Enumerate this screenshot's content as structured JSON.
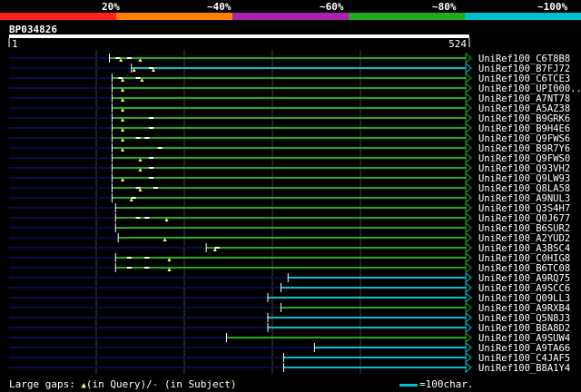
{
  "title": "BP034826",
  "colors": {
    "identity_bar": [
      "#ff2020",
      "#ff7f00",
      "#aa22aa",
      "#22aa22",
      "#00bfcf"
    ],
    "track": "#0a0a50",
    "green": "#22aa22",
    "cyan": "#00bfcf",
    "gap_marker": "#ffff66",
    "gridline": "#444444"
  },
  "identity_scale": [
    "20%",
    "~40%",
    "~60%",
    "~80%",
    "~100%"
  ],
  "legend": {
    "large_gaps": "Large gaps: ",
    "in_query": "(in Query)/",
    "dash": "-",
    "in_subject": " (in Subject)",
    "scale_note": "=100char."
  },
  "chart_data": {
    "type": "alignment",
    "query_start": 1,
    "query_end": 524,
    "start_label": "1",
    "end_label": "524",
    "hits": [
      {
        "name": "UniRef100_C6T8B8",
        "start": 115,
        "end": 520,
        "color": "green",
        "gaps": [
          122,
          135
        ],
        "tris": [
          128,
          150
        ]
      },
      {
        "name": "UniRef100_B7FJ72",
        "start": 140,
        "end": 520,
        "color": "cyan",
        "gaps": [
          160
        ],
        "tris": [
          143,
          165
        ]
      },
      {
        "name": "UniRef100_C6TCE3",
        "start": 118,
        "end": 520,
        "color": "green",
        "gaps": [
          125,
          145
        ],
        "tris": [
          130,
          152
        ]
      },
      {
        "name": "UniRef100_UPI000..",
        "start": 118,
        "end": 520,
        "color": "green",
        "gaps": [],
        "tris": [
          130
        ]
      },
      {
        "name": "UniRef100_A7NT78",
        "start": 118,
        "end": 520,
        "color": "green",
        "gaps": [],
        "tris": [
          130
        ]
      },
      {
        "name": "UniRef100_A5AZ38",
        "start": 118,
        "end": 520,
        "color": "green",
        "gaps": [],
        "tris": [
          130
        ]
      },
      {
        "name": "UniRef100_B9GRK6",
        "start": 118,
        "end": 520,
        "color": "green",
        "gaps": [
          160
        ],
        "tris": [
          130
        ]
      },
      {
        "name": "UniRef100_B9H4E6",
        "start": 118,
        "end": 520,
        "color": "green",
        "gaps": [
          160
        ],
        "tris": [
          130
        ]
      },
      {
        "name": "UniRef100_Q9FWS6",
        "start": 118,
        "end": 520,
        "color": "green",
        "gaps": [
          145,
          155
        ],
        "tris": [
          130
        ]
      },
      {
        "name": "UniRef100_B9R7Y6",
        "start": 118,
        "end": 520,
        "color": "green",
        "gaps": [
          170
        ],
        "tris": [
          130
        ]
      },
      {
        "name": "UniRef100_Q9FWS0",
        "start": 118,
        "end": 520,
        "color": "green",
        "gaps": [
          160
        ],
        "tris": [
          150
        ]
      },
      {
        "name": "UniRef100_Q93VH2",
        "start": 118,
        "end": 520,
        "color": "green",
        "gaps": [
          160
        ],
        "tris": [
          150
        ]
      },
      {
        "name": "UniRef100_Q9LW93",
        "start": 118,
        "end": 520,
        "color": "green",
        "gaps": [
          160
        ],
        "tris": [
          130
        ]
      },
      {
        "name": "UniRef100_Q8LA58",
        "start": 118,
        "end": 520,
        "color": "green",
        "gaps": [
          145,
          165
        ],
        "tris": [
          150
        ]
      },
      {
        "name": "UniRef100_A9NUL3",
        "start": 118,
        "end": 520,
        "color": "green",
        "gaps": [
          140
        ],
        "tris": [
          140
        ]
      },
      {
        "name": "UniRef100_Q3S4H7",
        "start": 122,
        "end": 520,
        "color": "green",
        "gaps": [],
        "tris": []
      },
      {
        "name": "UniRef100_Q0J677",
        "start": 122,
        "end": 520,
        "color": "green",
        "gaps": [
          145,
          155
        ],
        "tris": [
          180
        ]
      },
      {
        "name": "UniRef100_B6SUR2",
        "start": 122,
        "end": 520,
        "color": "green",
        "gaps": [],
        "tris": []
      },
      {
        "name": "UniRef100_A2YUD2",
        "start": 125,
        "end": 520,
        "color": "green",
        "gaps": [],
        "tris": [
          178
        ]
      },
      {
        "name": "UniRef100_A3BSC4",
        "start": 225,
        "end": 520,
        "color": "green",
        "gaps": [
          235
        ],
        "tris": [
          235
        ]
      },
      {
        "name": "UniRef100_C0HIG8",
        "start": 122,
        "end": 520,
        "color": "green",
        "gaps": [
          135,
          155
        ],
        "tris": [
          183
        ]
      },
      {
        "name": "UniRef100_B6TC08",
        "start": 122,
        "end": 520,
        "color": "green",
        "gaps": [
          135,
          155
        ],
        "tris": [
          183
        ]
      },
      {
        "name": "UniRef100_A9RQ75",
        "start": 318,
        "end": 520,
        "color": "cyan",
        "gaps": [],
        "tris": []
      },
      {
        "name": "UniRef100_A9SCC6",
        "start": 310,
        "end": 520,
        "color": "cyan",
        "gaps": [],
        "tris": []
      },
      {
        "name": "UniRef100_Q09LL3",
        "start": 295,
        "end": 520,
        "color": "cyan",
        "gaps": [],
        "tris": []
      },
      {
        "name": "UniRef100_A9RXB4",
        "start": 310,
        "end": 520,
        "color": "green",
        "gaps": [],
        "tris": []
      },
      {
        "name": "UniRef100_Q5N8J3",
        "start": 295,
        "end": 520,
        "color": "cyan",
        "gaps": [],
        "tris": []
      },
      {
        "name": "UniRef100_B8A8D2",
        "start": 295,
        "end": 520,
        "color": "cyan",
        "gaps": [],
        "tris": []
      },
      {
        "name": "UniRef100_A9SUW4",
        "start": 248,
        "end": 520,
        "color": "green",
        "gaps": [],
        "tris": []
      },
      {
        "name": "UniRef100_A9TA66",
        "start": 348,
        "end": 520,
        "color": "cyan",
        "gaps": [],
        "tris": []
      },
      {
        "name": "UniRef100_C4JAF5",
        "start": 313,
        "end": 520,
        "color": "cyan",
        "gaps": [],
        "tris": []
      },
      {
        "name": "UniRef100_B8A1Y4",
        "start": 313,
        "end": 520,
        "color": "cyan",
        "gaps": [],
        "tris": []
      }
    ]
  }
}
